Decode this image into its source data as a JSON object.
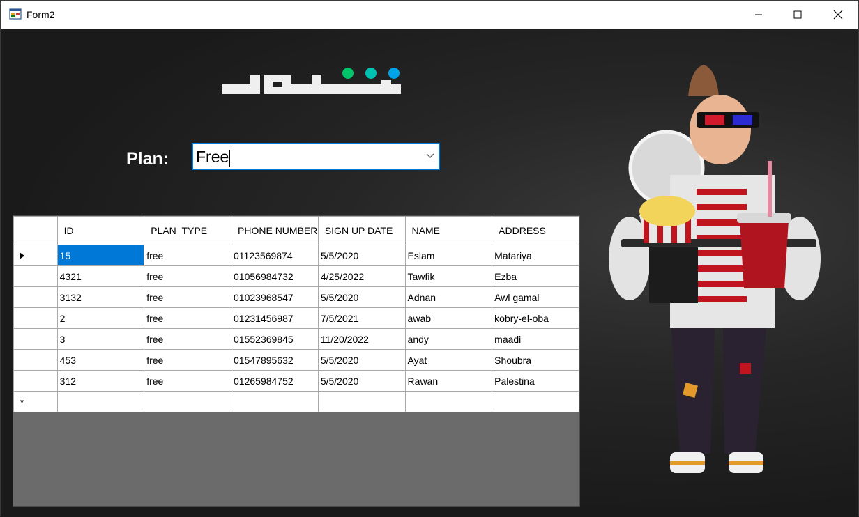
{
  "window": {
    "title": "Form2"
  },
  "plan": {
    "label": "Plan:",
    "value": "Free"
  },
  "grid": {
    "columns": [
      "ID",
      "PLAN_TYPE",
      "PHONE NUMBER",
      "SIGN UP DATE",
      "NAME",
      "ADDRESS"
    ],
    "rows": [
      [
        "15",
        "free",
        "01123569874",
        "5/5/2020",
        "Eslam",
        "Matariya"
      ],
      [
        "4321",
        "free",
        "01056984732",
        "4/25/2022",
        "Tawfik",
        "Ezba"
      ],
      [
        "3132",
        "free",
        "01023968547",
        "5/5/2020",
        "Adnan",
        "Awl gamal"
      ],
      [
        "2",
        "free",
        "01231456987",
        "7/5/2021",
        "awab",
        "kobry-el-oba"
      ],
      [
        "3",
        "free",
        "01552369845",
        "11/20/2022",
        "andy",
        "maadi"
      ],
      [
        "453",
        "free",
        "01547895632",
        "5/5/2020",
        "Ayat",
        "Shoubra"
      ],
      [
        "312",
        "free",
        "01265984752",
        "5/5/2020",
        "Rawan",
        "Palestina"
      ]
    ],
    "new_row_marker": "*"
  },
  "icons": {
    "app": "form-app-icon",
    "minimize": "minimize-icon",
    "maximize": "maximize-icon",
    "close": "close-icon",
    "dropdown": "chevron-down-icon",
    "current_row": "row-pointer-icon",
    "new_row": "new-row-asterisk-icon"
  },
  "colors": {
    "accent": "#0078d7",
    "background": "#191919",
    "logo_dot_green": "#00c46a",
    "logo_dot_teal": "#00c2b0",
    "logo_dot_blue": "#00a3e8"
  }
}
